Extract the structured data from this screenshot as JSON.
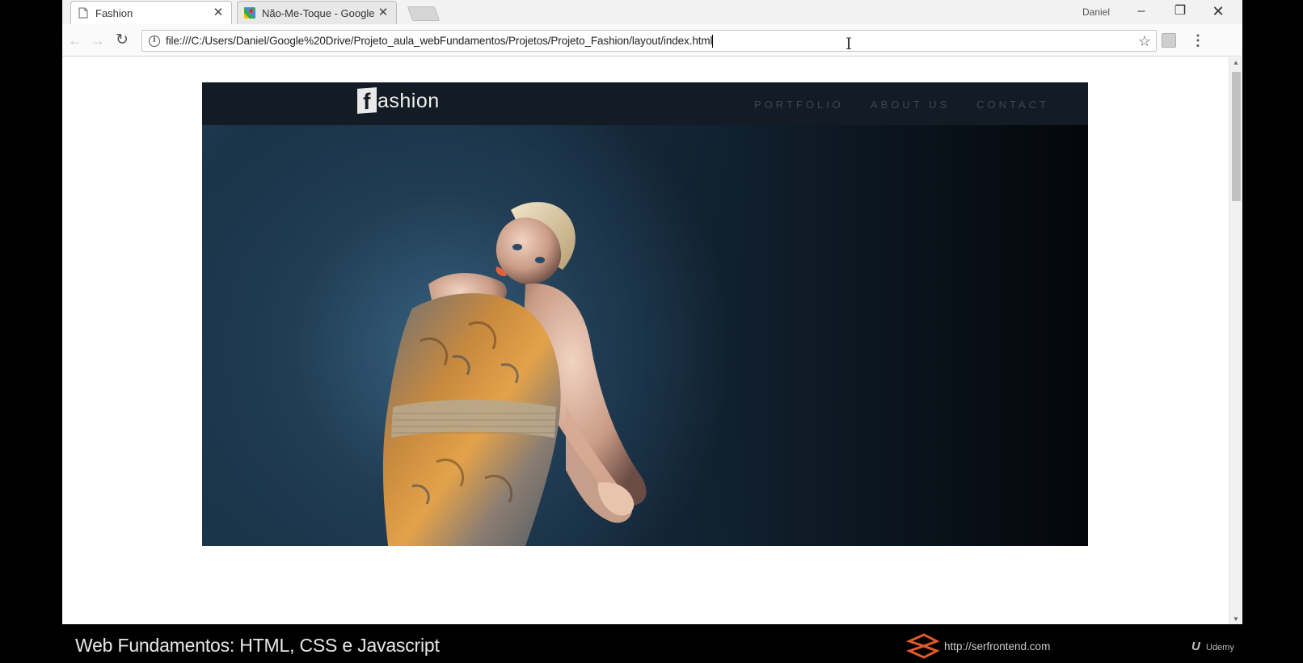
{
  "browser": {
    "tabs": [
      {
        "title": "Fashion",
        "icon": "page-icon",
        "active": true
      },
      {
        "title": "Não-Me-Toque - Google",
        "icon": "maps-icon",
        "active": false
      }
    ],
    "profile_name": "Daniel",
    "window_controls": {
      "minimize": "–",
      "restore": "❐",
      "close": "✕"
    },
    "toolbar": {
      "back": "←",
      "forward": "→",
      "reload": "↻",
      "info": "i",
      "url": "file:///C:/Users/Daniel/Google%20Drive/Projeto_aula_webFundamentos/Projetos/Projeto_Fashion/layout/index.html",
      "star": "☆",
      "menu": "⋮"
    }
  },
  "site": {
    "logo_mark": "f",
    "logo_text": "ashion",
    "menu": [
      "PORTFOLIO",
      "ABOUT US",
      "CONTACT"
    ]
  },
  "video_overlay": {
    "course_title": "Web Fundamentos: HTML, CSS e Javascript",
    "site_url": "http://serfrontend.com",
    "platform": "Udemy"
  },
  "colors": {
    "site_nav_bg": "#131c25",
    "menu_text": "#3b4752",
    "hero_blue": "#1d3a52"
  }
}
